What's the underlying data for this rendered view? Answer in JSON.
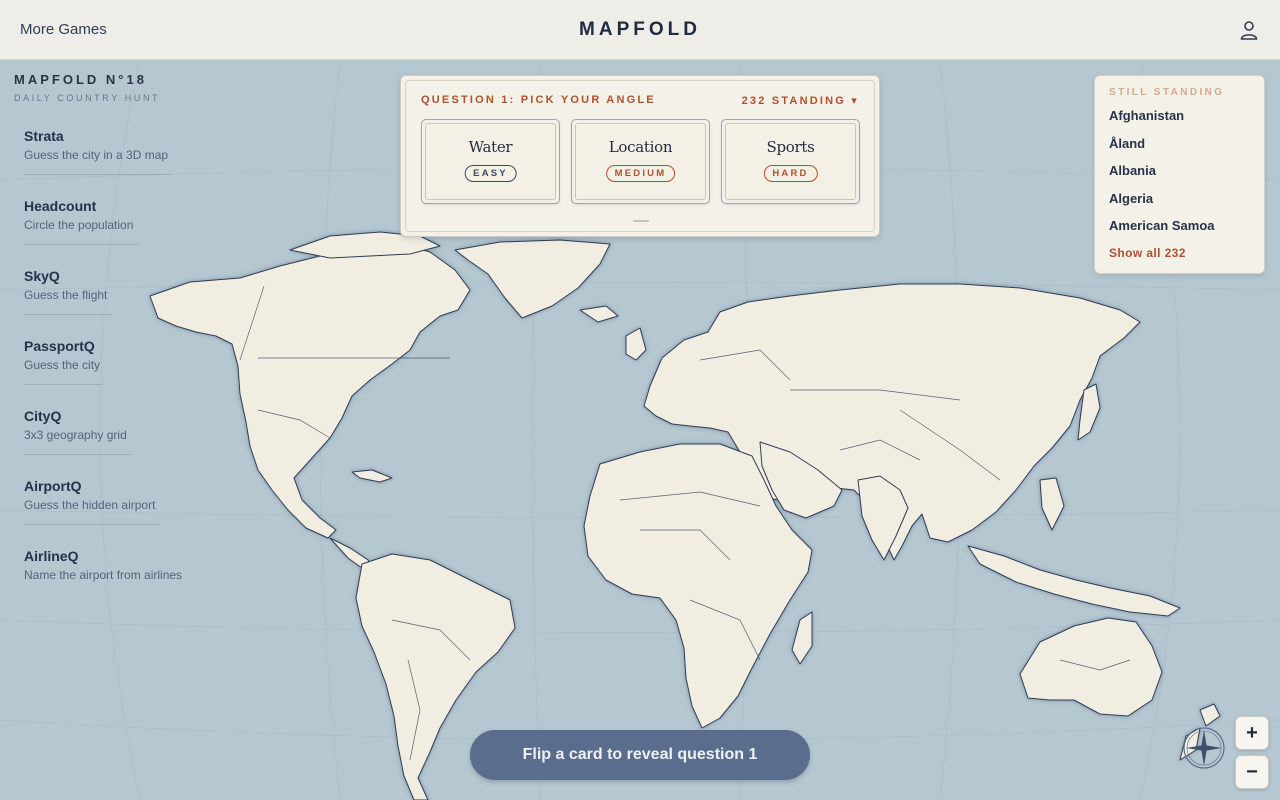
{
  "header": {
    "more_games": "More Games",
    "title": "MAPFOLD",
    "user_icon": "user-icon"
  },
  "edition": {
    "title": "MAPFOLD N°18",
    "subtitle": "DAILY COUNTRY HUNT"
  },
  "games": [
    {
      "name": "Strata",
      "desc": "Guess the city in a 3D map"
    },
    {
      "name": "Headcount",
      "desc": "Circle the population"
    },
    {
      "name": "SkyQ",
      "desc": "Guess the flight"
    },
    {
      "name": "PassportQ",
      "desc": "Guess the city"
    },
    {
      "name": "CityQ",
      "desc": "3x3 geography grid"
    },
    {
      "name": "AirportQ",
      "desc": "Guess the hidden airport"
    },
    {
      "name": "AirlineQ",
      "desc": "Name the airport from airlines"
    }
  ],
  "question": {
    "heading": "QUESTION 1: PICK YOUR ANGLE",
    "standing": "232 STANDING ▾",
    "cards": [
      {
        "title": "Water",
        "difficulty": "EASY"
      },
      {
        "title": "Location",
        "difficulty": "MEDIUM"
      },
      {
        "title": "Sports",
        "difficulty": "HARD"
      }
    ]
  },
  "still_standing": {
    "heading": "STILL STANDING",
    "items": [
      "Afghanistan",
      "Åland",
      "Albania",
      "Algeria",
      "American Samoa"
    ],
    "show_all": "Show all 232"
  },
  "actions": {
    "reveal": "Flip a card to reveal question 1",
    "zoom_in": "+",
    "zoom_out": "−"
  },
  "icons": [
    "user-icon",
    "compass-icon",
    "plus-icon",
    "minus-icon"
  ],
  "colors": {
    "ocean": "#b5c7d1",
    "land": "#f2ede1",
    "border": "#2f3e57",
    "accent": "#b0502f",
    "button": "#5a6d8c"
  }
}
